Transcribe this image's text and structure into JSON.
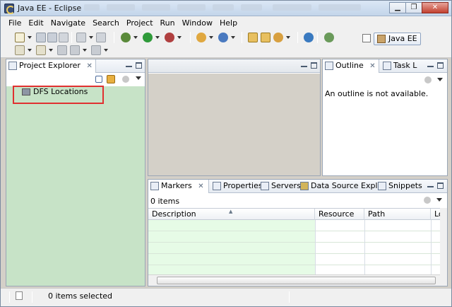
{
  "window": {
    "title": "Java EE - Eclipse"
  },
  "menubar": {
    "items": [
      "File",
      "Edit",
      "Navigate",
      "Search",
      "Project",
      "Run",
      "Window",
      "Help"
    ]
  },
  "toolbar": {
    "perspective_label": "Java EE"
  },
  "project_explorer": {
    "tab_label": "Project Explorer",
    "items": [
      {
        "label": "DFS Locations",
        "icon": "dfs-locations-icon"
      }
    ]
  },
  "outline": {
    "tab_label": "Outline",
    "second_tab_label": "Task L",
    "message": "An outline is not available."
  },
  "markers": {
    "tabs": [
      {
        "label": "Markers",
        "icon": "markers-icon",
        "active": true
      },
      {
        "label": "Properties",
        "icon": "properties-icon",
        "active": false
      },
      {
        "label": "Servers",
        "icon": "servers-icon",
        "active": false
      },
      {
        "label": "Data Source Explo",
        "icon": "data-source-icon",
        "active": false
      },
      {
        "label": "Snippets",
        "icon": "snippets-icon",
        "active": false
      }
    ],
    "count": "0 items",
    "columns": [
      "Description",
      "Resource",
      "Path",
      "Loc"
    ]
  },
  "statusbar": {
    "text": "0 items selected"
  },
  "colors": {
    "highlight_border": "#e03030",
    "explorer_bg": "#c7e3c7",
    "description_column_bg": "#e6fbe6"
  }
}
